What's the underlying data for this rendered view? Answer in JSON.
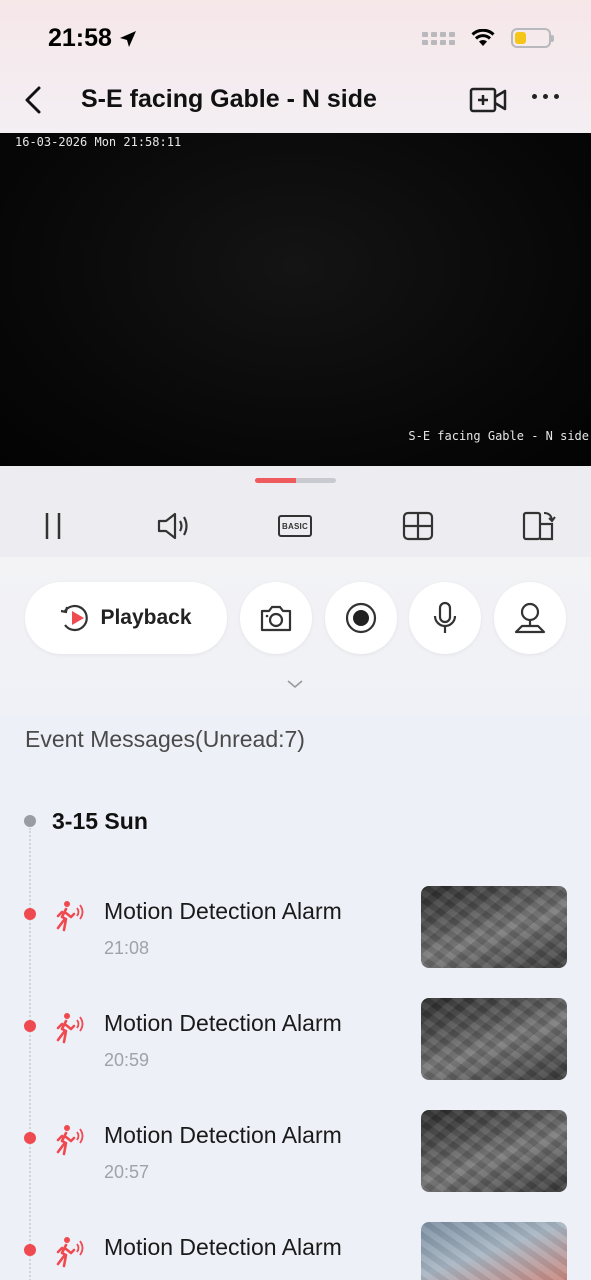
{
  "status_bar": {
    "time": "21:58"
  },
  "nav": {
    "title": "S-E facing Gable - N side"
  },
  "video": {
    "timestamp": "16-03-2026 Mon 21:58:11",
    "camera_name": "S-E facing Gable - N side",
    "buffer_progress": 0.5
  },
  "controls": {
    "quality_label": "BASIC"
  },
  "actions": {
    "playback_label": "Playback"
  },
  "events": {
    "header": "Event Messages(Unread:7)",
    "day_label": "3-15 Sun",
    "items": [
      {
        "title": "Motion Detection Alarm",
        "time": "21:08",
        "thumb": "grayscale"
      },
      {
        "title": "Motion Detection Alarm",
        "time": "20:59",
        "thumb": "grayscale"
      },
      {
        "title": "Motion Detection Alarm",
        "time": "20:57",
        "thumb": "grayscale"
      },
      {
        "title": "Motion Detection Alarm",
        "time": "",
        "thumb": "color"
      }
    ]
  },
  "colors": {
    "accent": "#ef4a4f",
    "progress": "#ef5a5c",
    "battery": "#f5c518"
  },
  "icons": [
    "location-arrow-icon",
    "signal-icon",
    "wifi-icon",
    "battery-icon",
    "back-icon",
    "add-camera-icon",
    "more-icon",
    "pause-icon",
    "speaker-icon",
    "quality-icon",
    "grid-icon",
    "rotate-screen-icon",
    "playback-icon",
    "camera-icon",
    "record-icon",
    "microphone-icon",
    "ptz-icon",
    "chevron-down-icon",
    "motion-alarm-icon"
  ]
}
